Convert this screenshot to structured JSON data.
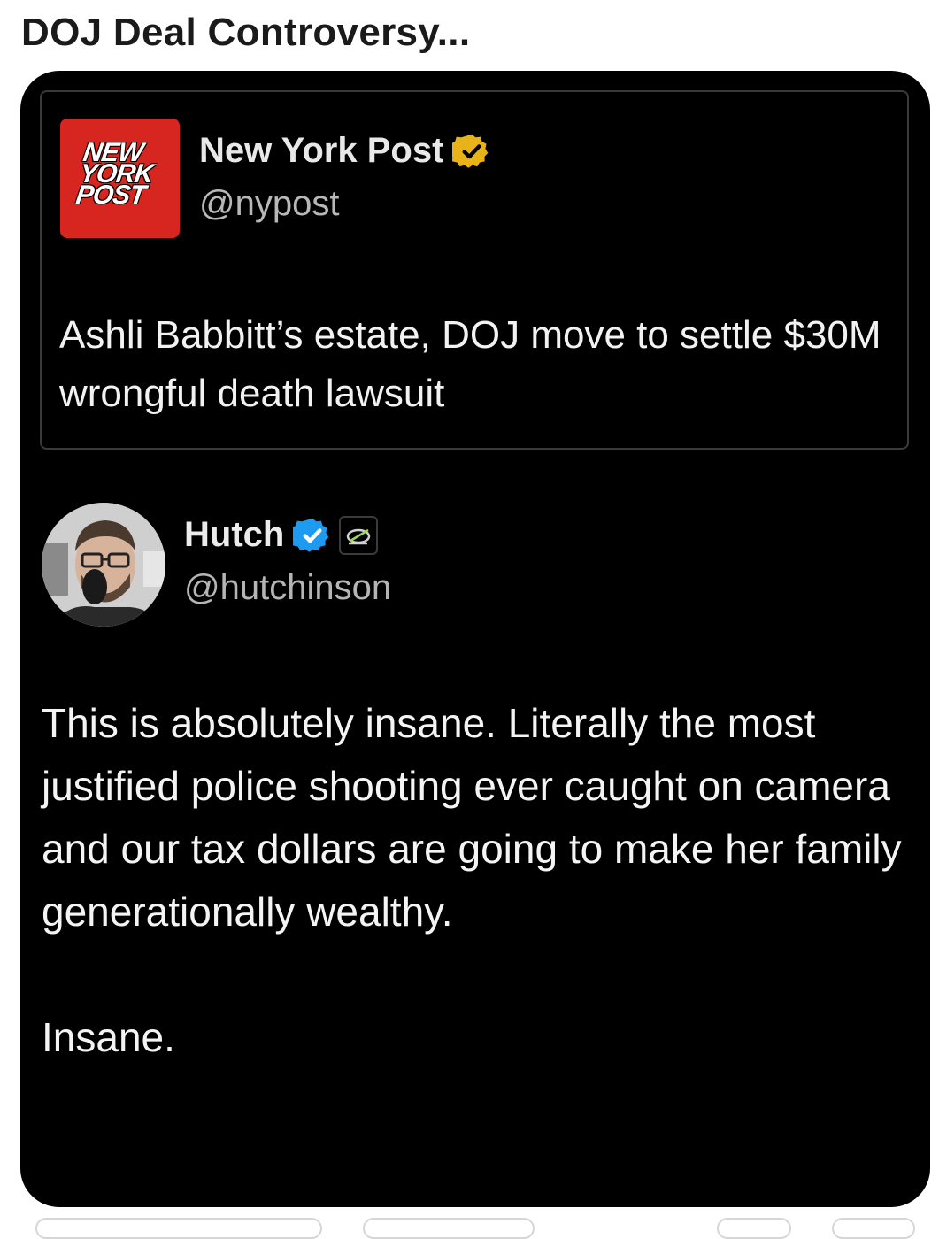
{
  "page": {
    "title": "DOJ Deal Controversy..."
  },
  "quoted_post": {
    "logo_words": [
      "NEW",
      "YORK",
      "POST"
    ],
    "display_name": "New York Post",
    "handle": "@nypost",
    "verified_badge": "gold-check-icon",
    "text": "Ashli Babbitt’s estate, DOJ move to settle $30M wrongful death lawsuit"
  },
  "post": {
    "display_name": "Hutch",
    "handle": "@hutchinson",
    "verified_badge": "blue-check-icon",
    "affiliation_badge": "optic-logo-icon",
    "text": "This is absolutely insane. Literally the most justified police shooting ever caught on camera and our tax dollars are going to make her family generationally wealthy.\n\nInsane."
  },
  "colors": {
    "card_background": "#000000",
    "logo_red": "#d6261f",
    "gold_badge": "#e8b318",
    "blue_badge": "#1d9bf0"
  }
}
